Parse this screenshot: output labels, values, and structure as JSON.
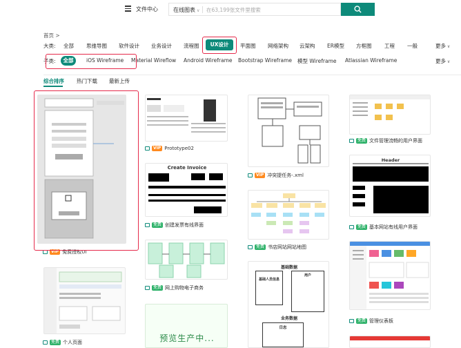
{
  "header": {
    "menu_icon": "hamburger-menu-icon",
    "file_center": "文件中心",
    "search_type": "在线图表",
    "search_placeholder": "在63,199张文件里搜索",
    "search_icon": "search-icon",
    "accent": "#0e8a7a"
  },
  "breadcrumb": "首页 >",
  "categories": {
    "label": "大类:",
    "items": [
      "全部",
      "思维导图",
      "软件设计",
      "业务设计",
      "流程图",
      "UX设计",
      "平面图",
      "网络架构",
      "云架构",
      "ER模型",
      "方框图",
      "工程",
      "一般"
    ],
    "active_index": 5,
    "more": "更多"
  },
  "subcategories": {
    "label": "子类:",
    "items": [
      "全部",
      "iOS Wireframe",
      "Material Wireflow",
      "Android Wireframe",
      "Bootstrap Wireframe",
      "模型 Wireframe",
      "Atlassian Wireframe"
    ],
    "active_index": 0,
    "more": "更多"
  },
  "sort_tabs": [
    "综合排序",
    "热门下载",
    "最新上传"
  ],
  "badges": {
    "vip": "VIP",
    "free": "免费"
  },
  "cards": [
    {
      "title": "免费授权UI",
      "badge": "vip"
    },
    {
      "title": "个人页面",
      "badge": "free"
    },
    {
      "title": "Prototype02",
      "badge": "vip"
    },
    {
      "title": "创建发票有线界面",
      "badge": "free"
    },
    {
      "title": "网上购物电子商务",
      "badge": "free"
    },
    {
      "title": "冲突提任务-.xml",
      "badge": "vip"
    },
    {
      "title": "书店网站网站地图",
      "badge": "free"
    },
    {
      "title": "文件管理流畅的用户界面",
      "badge": "free"
    },
    {
      "title": "基本网站有线用户界面",
      "badge": "free"
    },
    {
      "title": "管理仪表板",
      "badge": "free"
    }
  ],
  "thumb_text": {
    "create_invoice": "Create Invoice",
    "header": "Header",
    "preview": "预览生产中...",
    "basic_data": "基础数据",
    "basic_info": "基础人员信息",
    "user": "用户",
    "business_data": "业务数据",
    "log": "日志"
  }
}
